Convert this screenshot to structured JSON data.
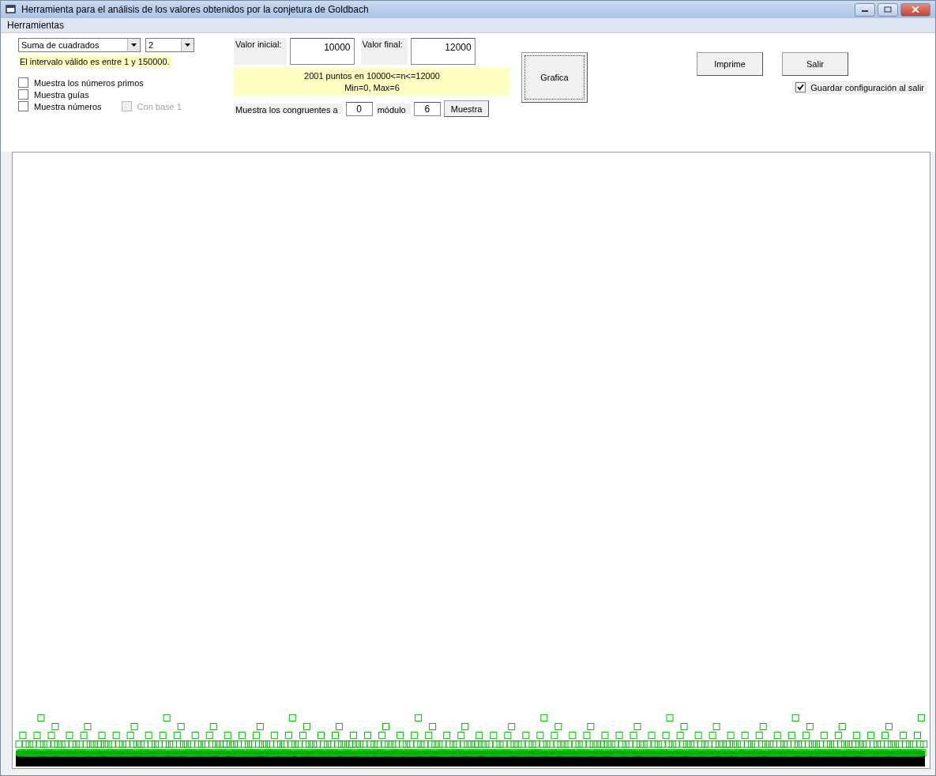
{
  "window": {
    "title": "Herramienta para el análisis de los valores obtenidos por la conjetura de Goldbach"
  },
  "menu": [
    {
      "label": "Herramientas"
    }
  ],
  "function_select": {
    "value": "Suma de cuadrados"
  },
  "order_select": {
    "value": "2"
  },
  "valid_range": "El intervalo válido es entre  1 y  150000.",
  "options": [
    {
      "label": "Muestra los números primos",
      "checked": false,
      "disabled": false
    },
    {
      "label": "Muestra guías",
      "checked": false,
      "disabled": false
    },
    {
      "label": "Muestra números",
      "checked": false,
      "disabled": false
    },
    {
      "label": "Con base 1",
      "checked": false,
      "disabled": true
    }
  ],
  "start": {
    "label": "Valor inicial:",
    "value": "10000"
  },
  "end": {
    "label": "Valor final:",
    "value": "12000"
  },
  "summary": [
    "2001 puntos en 10000<=n<=12000",
    "Min=0, Max=6"
  ],
  "congruence": {
    "label": "Muestra los congruentes a",
    "residue": "0",
    "modulus_label": "módulo",
    "modulus": "6",
    "button": "Muestra"
  },
  "graph_button": "Grafica",
  "print_button": "Imprime",
  "exit_button": "Salir",
  "save_on_exit": {
    "label": "Guardar configuración al salir",
    "checked": true
  }
}
